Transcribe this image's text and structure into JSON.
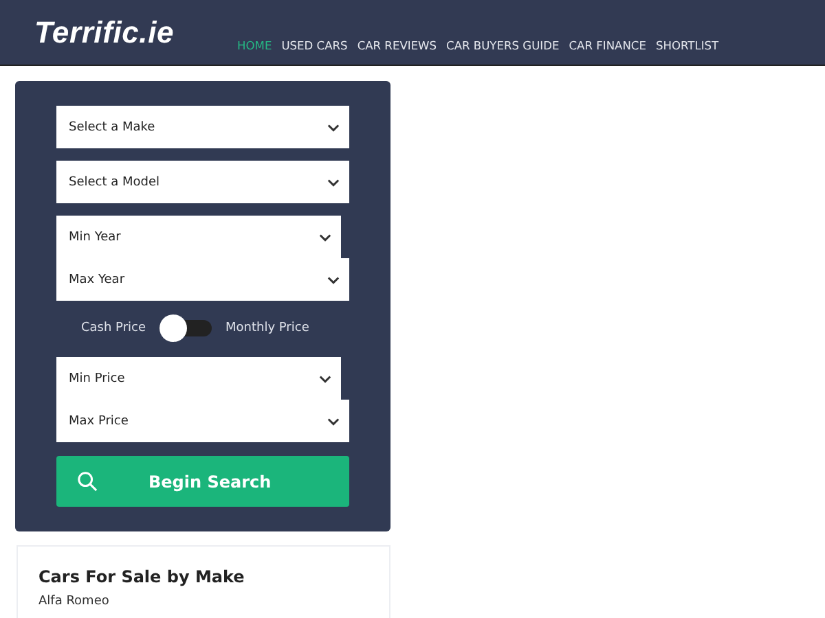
{
  "header": {
    "logo": "Terrific.ie",
    "nav": [
      {
        "label": "HOME",
        "selected": true
      },
      {
        "label": "USED CARS",
        "selected": false
      },
      {
        "label": "CAR REVIEWS",
        "selected": false
      },
      {
        "label": "CAR BUYERS GUIDE",
        "selected": false
      },
      {
        "label": "CAR FINANCE",
        "selected": false
      },
      {
        "label": "SHORTLIST",
        "selected": false
      }
    ]
  },
  "search": {
    "selects_top": [
      "Select a Make",
      "Select a Model",
      "Min Year",
      "Max Year"
    ],
    "price_toggle": {
      "left": "Cash Price",
      "right": "Monthly Price",
      "on": false
    },
    "selects_bottom": [
      "Min Price",
      "Max Price"
    ],
    "button": "Begin Search"
  },
  "makes": {
    "title": "Cars For Sale by Make",
    "items": [
      "Alfa Romeo"
    ]
  }
}
